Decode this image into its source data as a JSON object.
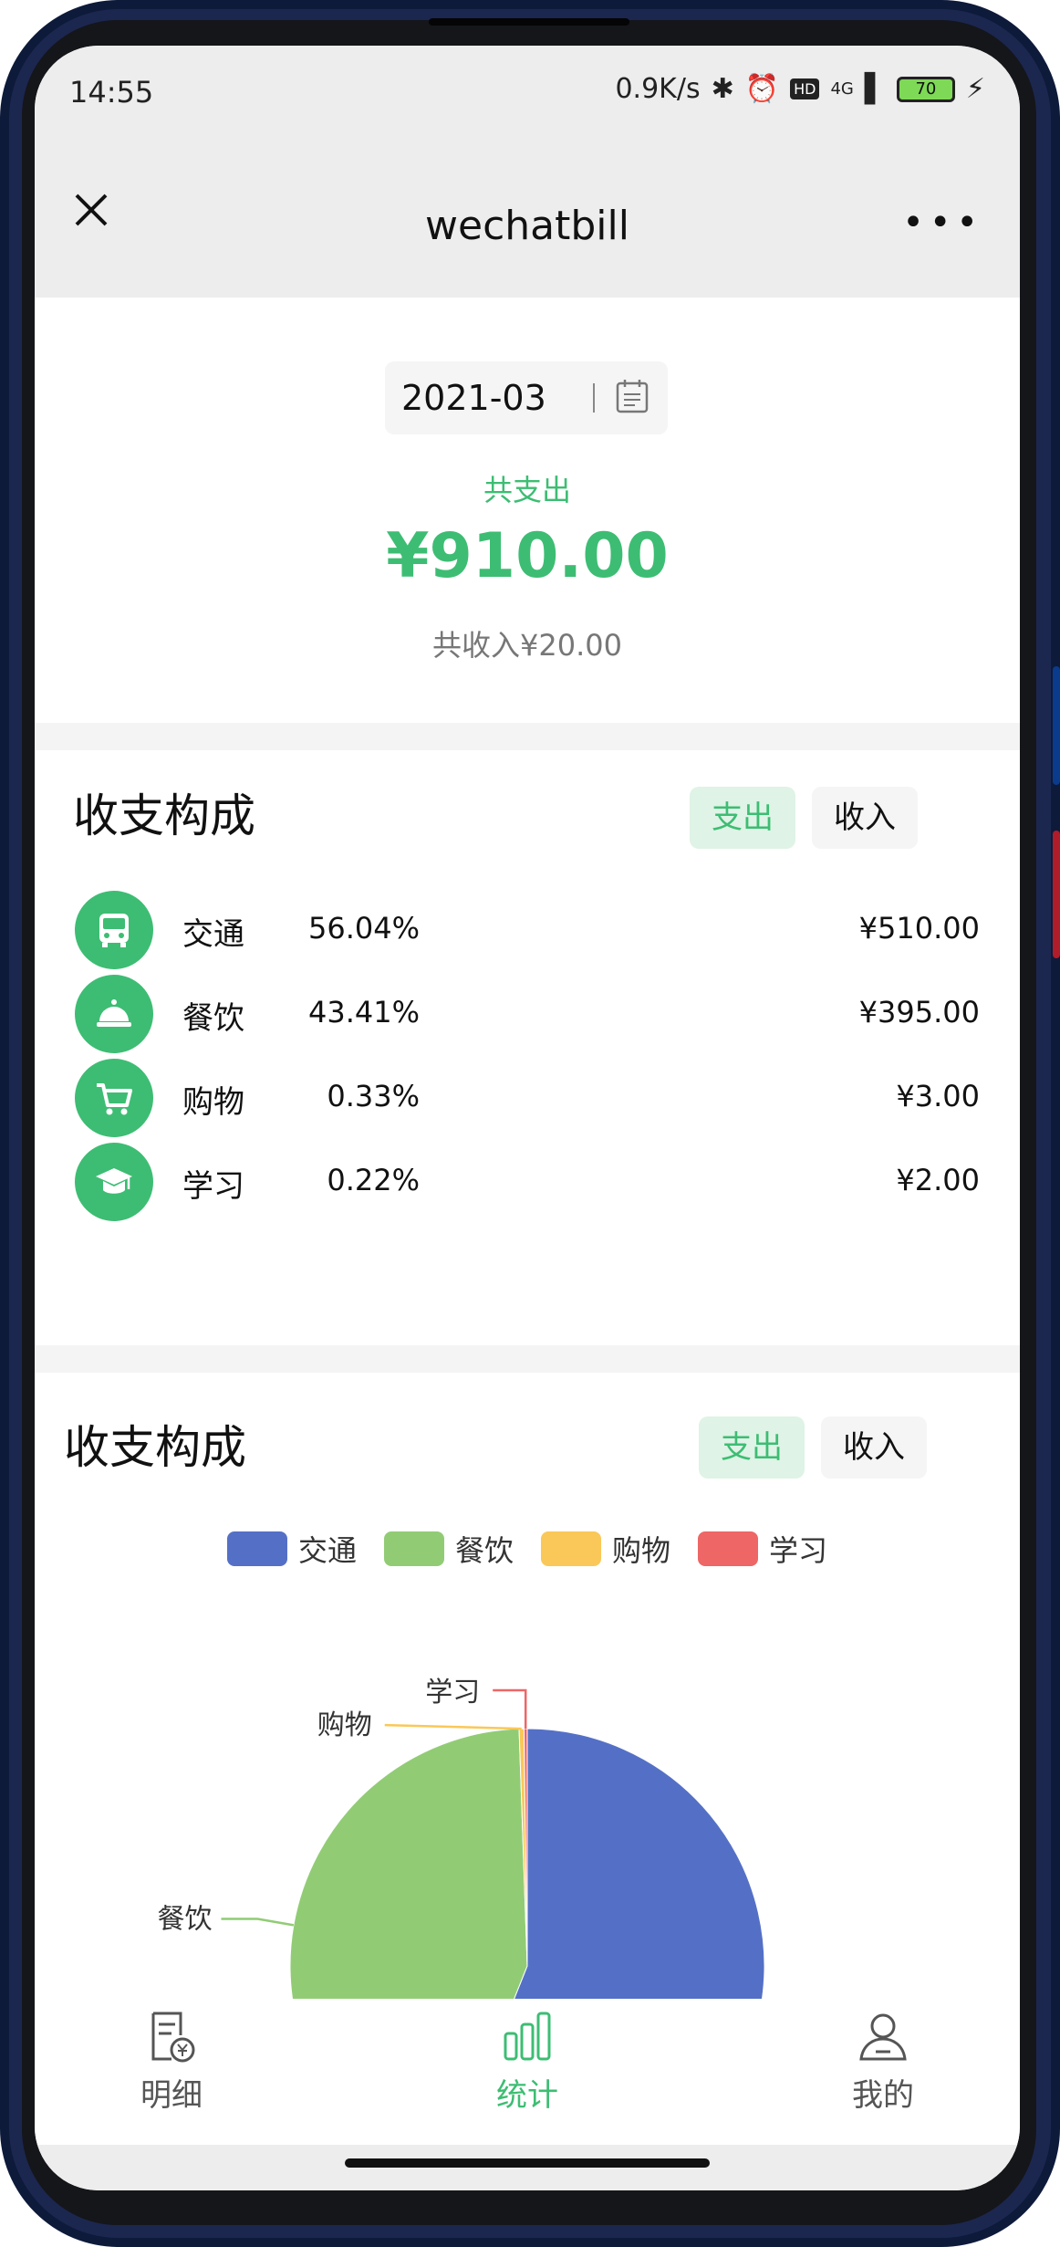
{
  "status": {
    "time": "14:55",
    "speed": "0.9K/s",
    "network": "4G",
    "battery": "70",
    "hd": "HD"
  },
  "titlebar": {
    "title": "wechatbill",
    "more": "•••"
  },
  "summary": {
    "month": "2021-03",
    "expense_label": "共支出",
    "expense_amount": "¥910.00",
    "income_summary": "共收入¥20.00"
  },
  "composition": {
    "title": "收支构成",
    "tab_expense": "支出",
    "tab_income": "收入",
    "items": [
      {
        "name": "交通",
        "percent": "56.04%",
        "amount": "¥510.00",
        "icon": "bus-icon"
      },
      {
        "name": "餐饮",
        "percent": "43.41%",
        "amount": "¥395.00",
        "icon": "food-cloche-icon"
      },
      {
        "name": "购物",
        "percent": "0.33%",
        "amount": "¥3.00",
        "icon": "shopping-cart-icon"
      },
      {
        "name": "学习",
        "percent": "0.22%",
        "amount": "¥2.00",
        "icon": "graduation-cap-icon"
      }
    ]
  },
  "chart_section": {
    "title": "收支构成",
    "tab_expense": "支出",
    "tab_income": "收入"
  },
  "chart_data": {
    "type": "pie",
    "categories": [
      "交通",
      "餐饮",
      "购物",
      "学习"
    ],
    "values": [
      510,
      395,
      3,
      2
    ],
    "colors": [
      "#5470c6",
      "#91cc75",
      "#fac858",
      "#ee6666"
    ],
    "legend": [
      "交通",
      "餐饮",
      "购物",
      "学习"
    ],
    "legend_position": "top",
    "slice_labels": [
      "学习",
      "购物",
      "餐饮"
    ]
  },
  "bottomnav": {
    "items": [
      {
        "label": "明细",
        "icon": "bill-detail-icon",
        "active": false
      },
      {
        "label": "统计",
        "icon": "bar-chart-icon",
        "active": true
      },
      {
        "label": "我的",
        "icon": "user-icon",
        "active": false
      }
    ],
    "active_color": "#3dbd73",
    "inactive_color": "#555555"
  }
}
